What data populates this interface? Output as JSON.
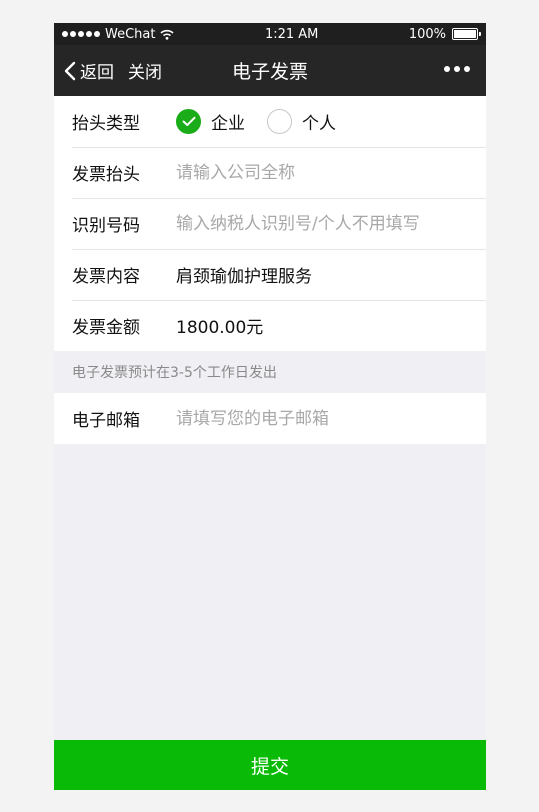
{
  "status_bar": {
    "carrier": "WeChat",
    "time": "1:21 AM",
    "battery": "100%",
    "battery_level": 1.0
  },
  "nav": {
    "back_label": "返回",
    "close_label": "关闭",
    "title": "电子发票"
  },
  "form": {
    "header_type": {
      "label": "抬头类型",
      "options": [
        {
          "label": "企业",
          "selected": true
        },
        {
          "label": "个人",
          "selected": false
        }
      ]
    },
    "invoice_title": {
      "label": "发票抬头",
      "placeholder": "请输入公司全称",
      "value": ""
    },
    "tax_id": {
      "label": "识别号码",
      "placeholder": "输入纳税人识别号/个人不用填写",
      "value": ""
    },
    "content": {
      "label": "发票内容",
      "value": "肩颈瑜伽护理服务"
    },
    "amount": {
      "label": "发票金额",
      "value": "1800.00元"
    }
  },
  "tip": "电子发票预计在3-5个工作日发出",
  "email": {
    "label": "电子邮箱",
    "placeholder": "请填写您的电子邮箱",
    "value": ""
  },
  "submit_label": "提交",
  "colors": {
    "accent": "#09bb07",
    "radio_checked": "#1aad19",
    "nav_bg": "#262626",
    "page_bg": "#efeff4"
  }
}
